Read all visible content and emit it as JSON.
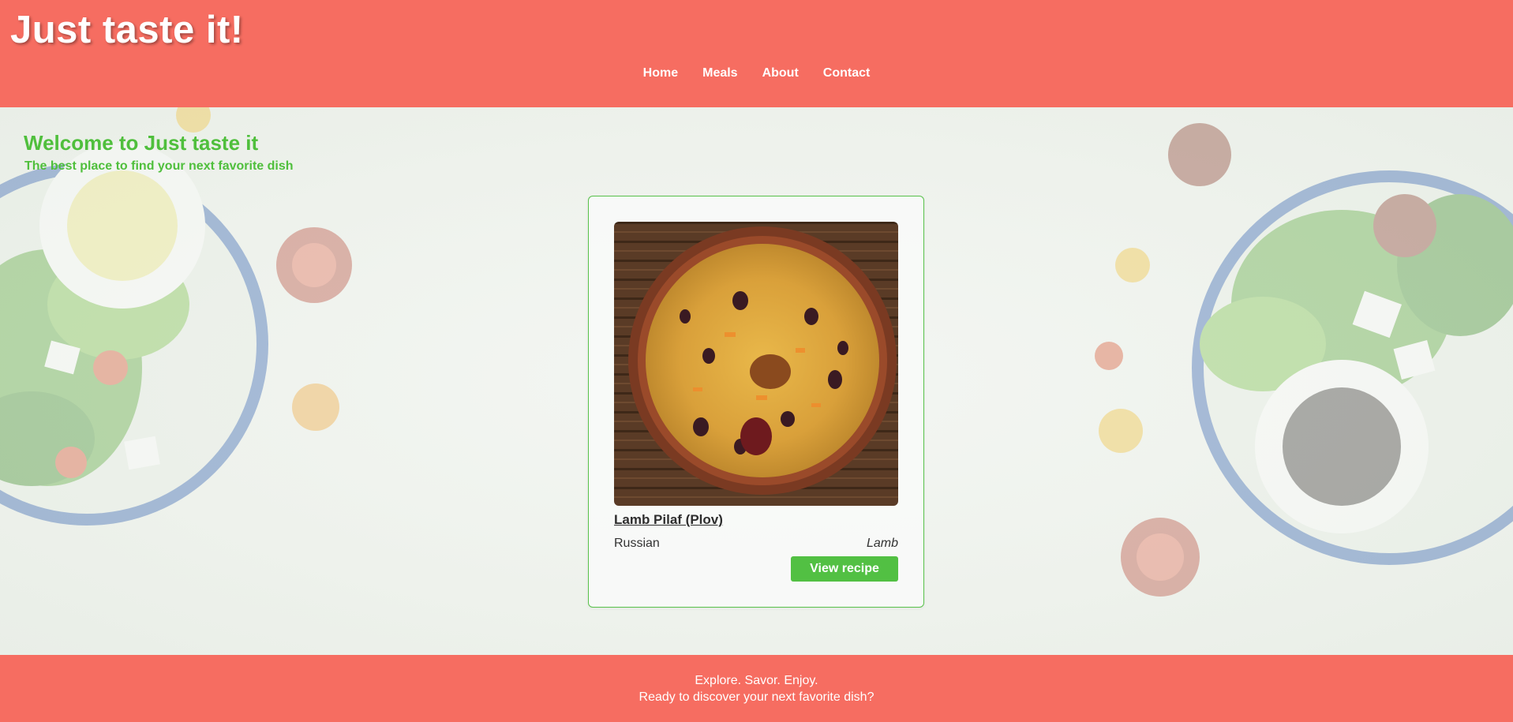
{
  "header": {
    "site_title": "Just taste it!",
    "nav": [
      {
        "label": "Home"
      },
      {
        "label": "Meals"
      },
      {
        "label": "About"
      },
      {
        "label": "Contact"
      }
    ]
  },
  "hero": {
    "title": "Welcome to Just taste it",
    "subtitle": "The best place to find your next favorite dish"
  },
  "meal_card": {
    "name": "Lamb Pilaf (Plov)",
    "cuisine": "Russian",
    "category": "Lamb",
    "button_label": "View recipe"
  },
  "footer": {
    "line1": "Explore. Savor. Enjoy.",
    "line2": "Ready to discover your next favorite dish?"
  },
  "colors": {
    "brand_coral": "#f66d61",
    "accent_green": "#52c043",
    "text_dark": "#333333"
  }
}
